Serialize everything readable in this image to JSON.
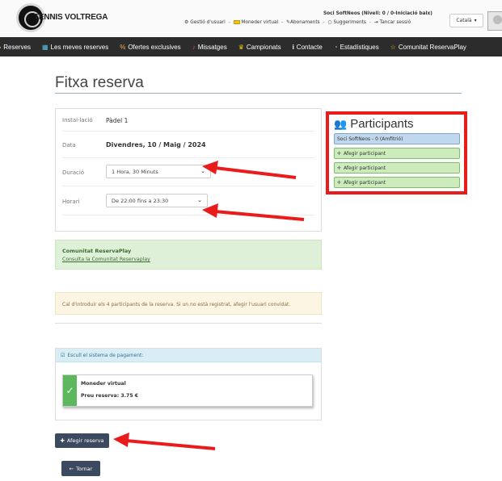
{
  "header": {
    "logo_text": "TENNIS VOLTREGA",
    "links": {
      "manage_user": "Gestió d'usuari",
      "wallet": "Moneder virtual",
      "subscriptions": "Abonaments",
      "suggestions": "Suggeriments",
      "logout": "Tancar sessió"
    },
    "user_status": "Soci SoftNeos (Nivell: 0 / 0-Iniciació baix)",
    "language": "Català",
    "language_caret": "▾"
  },
  "nav": {
    "items": [
      {
        "icon": "♣",
        "label": "Reserves"
      },
      {
        "icon": "▦",
        "label": "Les meves reserves"
      },
      {
        "icon": "%",
        "label": "Ofertes exclusives"
      },
      {
        "icon": "♪",
        "label": "Missatges"
      },
      {
        "icon": "♛",
        "label": "Campionats"
      },
      {
        "icon": "i",
        "label": "Contacte"
      },
      {
        "icon": "◔",
        "label": "Estadístiques"
      },
      {
        "icon": "☆",
        "label": "Comunitat ReservaPlay"
      }
    ]
  },
  "page": {
    "title": "Fitxa reserva"
  },
  "form": {
    "installation_label": "Instal·lació",
    "installation_value": "Pàdel 1",
    "date_label": "Data",
    "date_value": "Divendres, 10 / Maig / 2024",
    "duration_label": "Duració",
    "duration_value": "1 Hora, 30 Minuts",
    "schedule_label": "Horari",
    "schedule_value": "De 22:00 fins a 23:30"
  },
  "participants": {
    "title": "Participants",
    "host": "Soci SoftNeos - 0 (Amfitrió)",
    "add_label": "Afegir participant"
  },
  "community": {
    "title": "Comunitat ReservaPlay",
    "link": "Consulta la Comunitat Reservaplay"
  },
  "warning": {
    "text": "Cal d'introduir els 4 participants de la reserva. Si un no està registrat, afegir l'usuari convidat."
  },
  "payment": {
    "header": "Escull el sistema de pagament:",
    "method": "Moneder virtual",
    "price": "Preu reserva: 3.75 €"
  },
  "buttons": {
    "add": "Afegir reserva",
    "back": "Tornar"
  },
  "colors": {
    "nav_bg": "#2c2c2c",
    "highlight_red": "#ea1b1b",
    "button_bg": "#3b4a5e",
    "participant_green": "#ccecbb",
    "host_blue": "#bfd8ee"
  }
}
